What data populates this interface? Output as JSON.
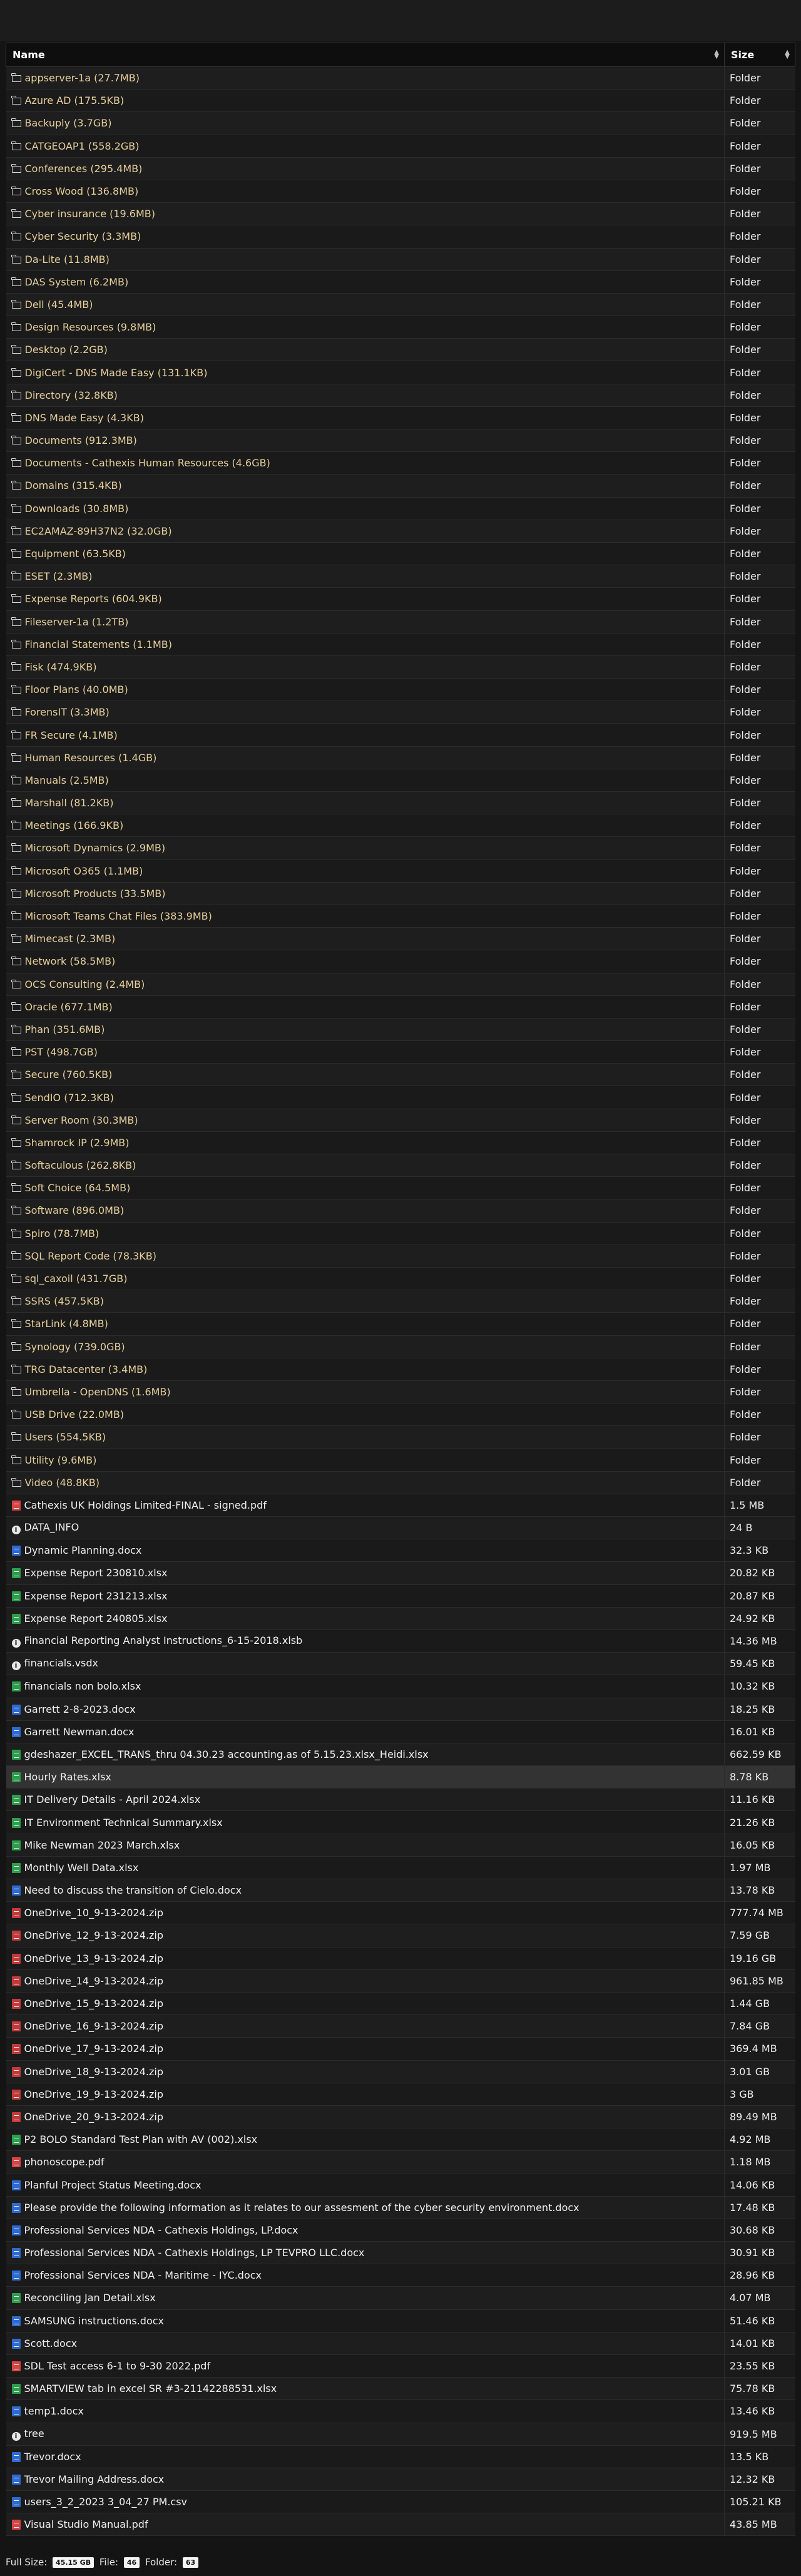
{
  "table": {
    "headers": {
      "name": "Name",
      "size": "Size"
    },
    "rows": [
      {
        "type": "folder",
        "icon": "folder-icon",
        "name": "appserver-1a (27.7MB)",
        "size": "Folder"
      },
      {
        "type": "folder",
        "icon": "folder-icon",
        "name": "Azure AD (175.5KB)",
        "size": "Folder"
      },
      {
        "type": "folder",
        "icon": "folder-icon",
        "name": "Backuply (3.7GB)",
        "size": "Folder"
      },
      {
        "type": "folder",
        "icon": "folder-icon",
        "name": "CATGEOAP1 (558.2GB)",
        "size": "Folder"
      },
      {
        "type": "folder",
        "icon": "folder-icon",
        "name": "Conferences (295.4MB)",
        "size": "Folder"
      },
      {
        "type": "folder",
        "icon": "folder-icon",
        "name": "Cross Wood (136.8MB)",
        "size": "Folder"
      },
      {
        "type": "folder",
        "icon": "folder-icon",
        "name": "Cyber insurance (19.6MB)",
        "size": "Folder"
      },
      {
        "type": "folder",
        "icon": "folder-icon",
        "name": "Cyber Security (3.3MB)",
        "size": "Folder"
      },
      {
        "type": "folder",
        "icon": "folder-icon",
        "name": "Da-Lite (11.8MB)",
        "size": "Folder"
      },
      {
        "type": "folder",
        "icon": "folder-icon",
        "name": "DAS System (6.2MB)",
        "size": "Folder"
      },
      {
        "type": "folder",
        "icon": "folder-icon",
        "name": "Dell (45.4MB)",
        "size": "Folder"
      },
      {
        "type": "folder",
        "icon": "folder-icon",
        "name": "Design Resources (9.8MB)",
        "size": "Folder"
      },
      {
        "type": "folder",
        "icon": "folder-icon",
        "name": "Desktop (2.2GB)",
        "size": "Folder"
      },
      {
        "type": "folder",
        "icon": "folder-icon",
        "name": "DigiCert - DNS Made Easy (131.1KB)",
        "size": "Folder"
      },
      {
        "type": "folder",
        "icon": "folder-icon",
        "name": "Directory (32.8KB)",
        "size": "Folder"
      },
      {
        "type": "folder",
        "icon": "folder-icon",
        "name": "DNS Made Easy (4.3KB)",
        "size": "Folder"
      },
      {
        "type": "folder",
        "icon": "folder-icon",
        "name": "Documents (912.3MB)",
        "size": "Folder"
      },
      {
        "type": "folder",
        "icon": "folder-icon",
        "name": "Documents - Cathexis Human Resources (4.6GB)",
        "size": "Folder"
      },
      {
        "type": "folder",
        "icon": "folder-icon",
        "name": "Domains (315.4KB)",
        "size": "Folder"
      },
      {
        "type": "folder",
        "icon": "folder-icon",
        "name": "Downloads (30.8MB)",
        "size": "Folder"
      },
      {
        "type": "folder",
        "icon": "folder-icon",
        "name": "EC2AMAZ-89H37N2 (32.0GB)",
        "size": "Folder"
      },
      {
        "type": "folder",
        "icon": "folder-icon",
        "name": "Equipment (63.5KB)",
        "size": "Folder"
      },
      {
        "type": "folder",
        "icon": "folder-icon",
        "name": "ESET (2.3MB)",
        "size": "Folder"
      },
      {
        "type": "folder",
        "icon": "folder-icon",
        "name": "Expense Reports (604.9KB)",
        "size": "Folder"
      },
      {
        "type": "folder",
        "icon": "folder-icon",
        "name": "Fileserver-1a (1.2TB)",
        "size": "Folder"
      },
      {
        "type": "folder",
        "icon": "folder-icon",
        "name": "Financial Statements (1.1MB)",
        "size": "Folder"
      },
      {
        "type": "folder",
        "icon": "folder-icon",
        "name": "Fisk (474.9KB)",
        "size": "Folder"
      },
      {
        "type": "folder",
        "icon": "folder-icon",
        "name": "Floor Plans (40.0MB)",
        "size": "Folder"
      },
      {
        "type": "folder",
        "icon": "folder-icon",
        "name": "ForensIT (3.3MB)",
        "size": "Folder"
      },
      {
        "type": "folder",
        "icon": "folder-icon",
        "name": "FR Secure (4.1MB)",
        "size": "Folder"
      },
      {
        "type": "folder",
        "icon": "folder-icon",
        "name": "Human Resources (1.4GB)",
        "size": "Folder"
      },
      {
        "type": "folder",
        "icon": "folder-icon",
        "name": "Manuals (2.5MB)",
        "size": "Folder"
      },
      {
        "type": "folder",
        "icon": "folder-icon",
        "name": "Marshall (81.2KB)",
        "size": "Folder"
      },
      {
        "type": "folder",
        "icon": "folder-icon",
        "name": "Meetings (166.9KB)",
        "size": "Folder"
      },
      {
        "type": "folder",
        "icon": "folder-icon",
        "name": "Microsoft Dynamics (2.9MB)",
        "size": "Folder"
      },
      {
        "type": "folder",
        "icon": "folder-icon",
        "name": "Microsoft O365 (1.1MB)",
        "size": "Folder"
      },
      {
        "type": "folder",
        "icon": "folder-icon",
        "name": "Microsoft Products (33.5MB)",
        "size": "Folder"
      },
      {
        "type": "folder",
        "icon": "folder-icon",
        "name": "Microsoft Teams Chat Files (383.9MB)",
        "size": "Folder"
      },
      {
        "type": "folder",
        "icon": "folder-icon",
        "name": "Mimecast (2.3MB)",
        "size": "Folder"
      },
      {
        "type": "folder",
        "icon": "folder-icon",
        "name": "Network (58.5MB)",
        "size": "Folder"
      },
      {
        "type": "folder",
        "icon": "folder-icon",
        "name": "OCS Consulting (2.4MB)",
        "size": "Folder"
      },
      {
        "type": "folder",
        "icon": "folder-icon",
        "name": "Oracle (677.1MB)",
        "size": "Folder"
      },
      {
        "type": "folder",
        "icon": "folder-icon",
        "name": "Phan (351.6MB)",
        "size": "Folder"
      },
      {
        "type": "folder",
        "icon": "folder-icon",
        "name": "PST (498.7GB)",
        "size": "Folder"
      },
      {
        "type": "folder",
        "icon": "folder-icon",
        "name": "Secure (760.5KB)",
        "size": "Folder"
      },
      {
        "type": "folder",
        "icon": "folder-icon",
        "name": "SendIO (712.3KB)",
        "size": "Folder"
      },
      {
        "type": "folder",
        "icon": "folder-icon",
        "name": "Server Room (30.3MB)",
        "size": "Folder"
      },
      {
        "type": "folder",
        "icon": "folder-icon",
        "name": "Shamrock IP (2.9MB)",
        "size": "Folder"
      },
      {
        "type": "folder",
        "icon": "folder-icon",
        "name": "Softaculous (262.8KB)",
        "size": "Folder"
      },
      {
        "type": "folder",
        "icon": "folder-icon",
        "name": "Soft Choice (64.5MB)",
        "size": "Folder"
      },
      {
        "type": "folder",
        "icon": "folder-icon",
        "name": "Software (896.0MB)",
        "size": "Folder"
      },
      {
        "type": "folder",
        "icon": "folder-icon",
        "name": "Spiro (78.7MB)",
        "size": "Folder"
      },
      {
        "type": "folder",
        "icon": "folder-icon",
        "name": "SQL Report Code (78.3KB)",
        "size": "Folder"
      },
      {
        "type": "folder",
        "icon": "folder-icon",
        "name": "sql_caxoil (431.7GB)",
        "size": "Folder"
      },
      {
        "type": "folder",
        "icon": "folder-icon",
        "name": "SSRS (457.5KB)",
        "size": "Folder"
      },
      {
        "type": "folder",
        "icon": "folder-icon",
        "name": "StarLink (4.8MB)",
        "size": "Folder"
      },
      {
        "type": "folder",
        "icon": "folder-icon",
        "name": "Synology (739.0GB)",
        "size": "Folder"
      },
      {
        "type": "folder",
        "icon": "folder-icon",
        "name": "TRG Datacenter (3.4MB)",
        "size": "Folder"
      },
      {
        "type": "folder",
        "icon": "folder-icon",
        "name": "Umbrella - OpenDNS (1.6MB)",
        "size": "Folder"
      },
      {
        "type": "folder",
        "icon": "folder-icon",
        "name": "USB Drive (22.0MB)",
        "size": "Folder"
      },
      {
        "type": "folder",
        "icon": "folder-icon",
        "name": "Users (554.5KB)",
        "size": "Folder"
      },
      {
        "type": "folder",
        "icon": "folder-icon",
        "name": "Utility (9.6MB)",
        "size": "Folder"
      },
      {
        "type": "folder",
        "icon": "folder-icon",
        "name": "Video (48.8KB)",
        "size": "Folder"
      },
      {
        "type": "file",
        "icon": "pdf-icon",
        "name": "Cathexis UK Holdings Limited-FINAL - signed.pdf",
        "size": "1.5 MB"
      },
      {
        "type": "file",
        "icon": "info-icon",
        "name": "DATA_INFO",
        "size": "24 B"
      },
      {
        "type": "file",
        "icon": "word-icon",
        "name": "Dynamic Planning.docx",
        "size": "32.3 KB"
      },
      {
        "type": "file",
        "icon": "excel-icon",
        "name": "Expense Report 230810.xlsx",
        "size": "20.82 KB"
      },
      {
        "type": "file",
        "icon": "excel-icon",
        "name": "Expense Report 231213.xlsx",
        "size": "20.87 KB"
      },
      {
        "type": "file",
        "icon": "excel-icon",
        "name": "Expense Report 240805.xlsx",
        "size": "24.92 KB"
      },
      {
        "type": "file",
        "icon": "info-icon",
        "name": "Financial Reporting Analyst Instructions_6-15-2018.xlsb",
        "size": "14.36 MB"
      },
      {
        "type": "file",
        "icon": "info-icon",
        "name": "financials.vsdx",
        "size": "59.45 KB"
      },
      {
        "type": "file",
        "icon": "excel-icon",
        "name": "financials non bolo.xlsx",
        "size": "10.32 KB"
      },
      {
        "type": "file",
        "icon": "word-icon",
        "name": "Garrett 2-8-2023.docx",
        "size": "18.25 KB"
      },
      {
        "type": "file",
        "icon": "word-icon",
        "name": "Garrett Newman.docx",
        "size": "16.01 KB"
      },
      {
        "type": "file",
        "icon": "excel-icon",
        "name": "gdeshazer_EXCEL_TRANS_thru 04.30.23 accounting.as of 5.15.23.xlsx_Heidi.xlsx",
        "size": "662.59 KB"
      },
      {
        "type": "file",
        "icon": "excel-icon",
        "name": "Hourly Rates.xlsx",
        "size": "8.78 KB",
        "highlight": true
      },
      {
        "type": "file",
        "icon": "excel-icon",
        "name": "IT Delivery Details - April 2024.xlsx",
        "size": "11.16 KB"
      },
      {
        "type": "file",
        "icon": "excel-icon",
        "name": "IT Environment Technical Summary.xlsx",
        "size": "21.26 KB"
      },
      {
        "type": "file",
        "icon": "excel-icon",
        "name": "Mike Newman 2023 March.xlsx",
        "size": "16.05 KB"
      },
      {
        "type": "file",
        "icon": "excel-icon",
        "name": "Monthly Well Data.xlsx",
        "size": "1.97 MB"
      },
      {
        "type": "file",
        "icon": "word-icon",
        "name": "Need to discuss the transition of Cielo.docx",
        "size": "13.78 KB"
      },
      {
        "type": "file",
        "icon": "zip-icon",
        "name": "OneDrive_10_9-13-2024.zip",
        "size": "777.74 MB"
      },
      {
        "type": "file",
        "icon": "zip-icon",
        "name": "OneDrive_12_9-13-2024.zip",
        "size": "7.59 GB"
      },
      {
        "type": "file",
        "icon": "zip-icon",
        "name": "OneDrive_13_9-13-2024.zip",
        "size": "19.16 GB"
      },
      {
        "type": "file",
        "icon": "zip-icon",
        "name": "OneDrive_14_9-13-2024.zip",
        "size": "961.85 MB"
      },
      {
        "type": "file",
        "icon": "zip-icon",
        "name": "OneDrive_15_9-13-2024.zip",
        "size": "1.44 GB"
      },
      {
        "type": "file",
        "icon": "zip-icon",
        "name": "OneDrive_16_9-13-2024.zip",
        "size": "7.84 GB"
      },
      {
        "type": "file",
        "icon": "zip-icon",
        "name": "OneDrive_17_9-13-2024.zip",
        "size": "369.4 MB"
      },
      {
        "type": "file",
        "icon": "zip-icon",
        "name": "OneDrive_18_9-13-2024.zip",
        "size": "3.01 GB"
      },
      {
        "type": "file",
        "icon": "zip-icon",
        "name": "OneDrive_19_9-13-2024.zip",
        "size": "3 GB"
      },
      {
        "type": "file",
        "icon": "zip-icon",
        "name": "OneDrive_20_9-13-2024.zip",
        "size": "89.49 MB"
      },
      {
        "type": "file",
        "icon": "excel-icon",
        "name": "P2 BOLO Standard Test Plan with AV (002).xlsx",
        "size": "4.92 MB"
      },
      {
        "type": "file",
        "icon": "pdf-icon",
        "name": "phonoscope.pdf",
        "size": "1.18 MB"
      },
      {
        "type": "file",
        "icon": "word-icon",
        "name": "Planful Project Status Meeting.docx",
        "size": "14.06 KB"
      },
      {
        "type": "file",
        "icon": "word-icon",
        "name": "Please provide the following information as it relates to our assesment of the cyber security environment.docx",
        "size": "17.48 KB"
      },
      {
        "type": "file",
        "icon": "word-icon",
        "name": "Professional Services NDA - Cathexis Holdings, LP.docx",
        "size": "30.68 KB"
      },
      {
        "type": "file",
        "icon": "word-icon",
        "name": "Professional Services NDA - Cathexis Holdings, LP TEVPRO LLC.docx",
        "size": "30.91 KB"
      },
      {
        "type": "file",
        "icon": "word-icon",
        "name": "Professional Services NDA - Maritime - IYC.docx",
        "size": "28.96 KB"
      },
      {
        "type": "file",
        "icon": "excel-icon",
        "name": "Reconciling Jan Detail.xlsx",
        "size": "4.07 MB"
      },
      {
        "type": "file",
        "icon": "word-icon",
        "name": "SAMSUNG instructions.docx",
        "size": "51.46 KB"
      },
      {
        "type": "file",
        "icon": "word-icon",
        "name": "Scott.docx",
        "size": "14.01 KB"
      },
      {
        "type": "file",
        "icon": "pdf-icon",
        "name": "SDL Test access 6-1 to 9-30 2022.pdf",
        "size": "23.55 KB"
      },
      {
        "type": "file",
        "icon": "excel-icon",
        "name": "SMARTVIEW tab in excel SR #3-21142288531.xlsx",
        "size": "75.78 KB"
      },
      {
        "type": "file",
        "icon": "word-icon",
        "name": "temp1.docx",
        "size": "13.46 KB"
      },
      {
        "type": "file",
        "icon": "info-icon",
        "name": "tree",
        "size": "919.5 MB"
      },
      {
        "type": "file",
        "icon": "word-icon",
        "name": "Trevor.docx",
        "size": "13.5 KB"
      },
      {
        "type": "file",
        "icon": "word-icon",
        "name": "Trevor Mailing Address.docx",
        "size": "12.32 KB"
      },
      {
        "type": "file",
        "icon": "csv-icon",
        "name": "users_3_2_2023 3_04_27 PM.csv",
        "size": "105.21 KB"
      },
      {
        "type": "file",
        "icon": "pdf-icon",
        "name": "Visual Studio Manual.pdf",
        "size": "43.85 MB"
      }
    ]
  },
  "footer": {
    "full_size_label": "Full Size:",
    "full_size_value": "45.15 GB",
    "file_label": "File:",
    "file_count": "46",
    "folder_label": "Folder:",
    "folder_count": "63"
  },
  "colors": {
    "folder_text": "#e6cf9c",
    "pdf": "#d64545",
    "excel": "#2e9d4d",
    "word": "#2f6ad1"
  }
}
